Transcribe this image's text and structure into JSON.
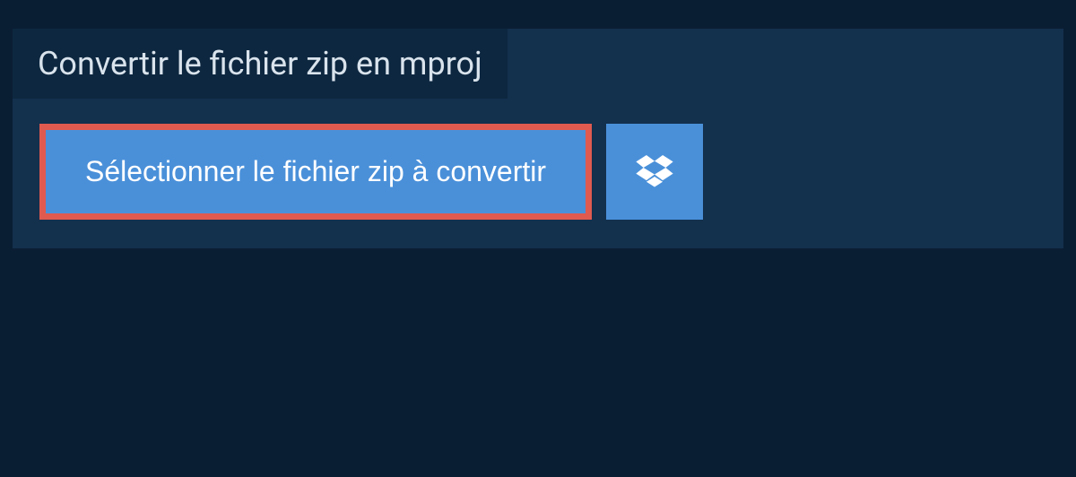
{
  "header": {
    "title": "Convertir le fichier zip en mproj"
  },
  "actions": {
    "select_file_label": "Sélectionner le fichier zip à convertir",
    "dropbox_icon_name": "dropbox"
  },
  "colors": {
    "page_bg": "#0a1e33",
    "panel_bg": "#13304d",
    "title_bg": "#0d2740",
    "button_bg": "#4a90d9",
    "highlight_border": "#e05a4f",
    "text_light": "#d9e3ec"
  }
}
